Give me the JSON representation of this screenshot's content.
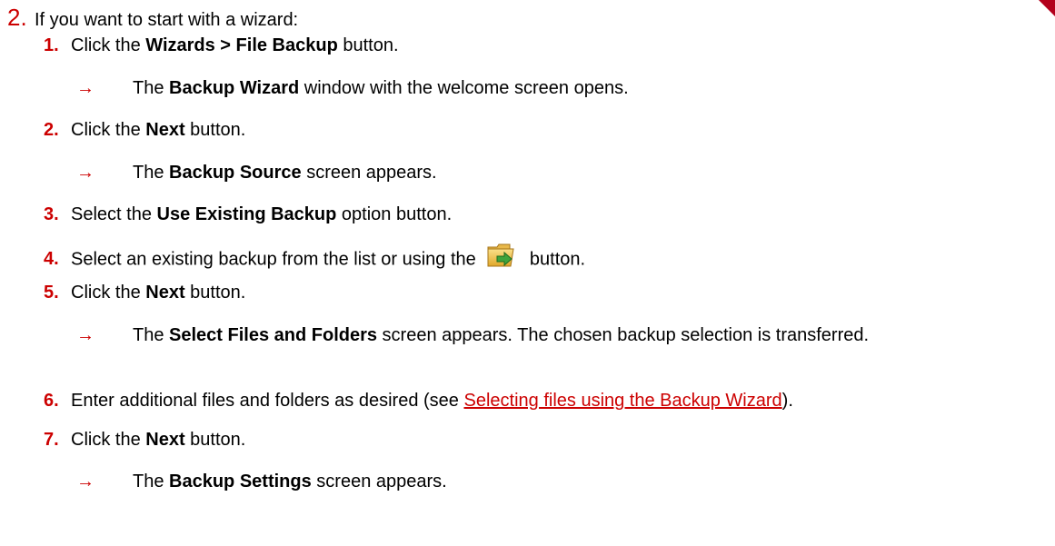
{
  "step": {
    "number": "2.",
    "text": "If you want to start with a wizard:"
  },
  "arrow_glyph": "→",
  "substeps": [
    {
      "num": "1.",
      "pre": "Click the ",
      "bold": "Wizards > File Backup",
      "post": " button."
    },
    {
      "num": "2.",
      "pre": "Click the ",
      "bold": "Next",
      "post": " button."
    },
    {
      "num": "3.",
      "pre": "Select the ",
      "bold": "Use Existing Backup",
      "post": " option button."
    },
    {
      "num": "4.",
      "pre": "Select an existing backup from the list or using the ",
      "icon": "open-folder-arrow-icon",
      "post": " button."
    },
    {
      "num": "5.",
      "pre": "Click the ",
      "bold": "Next",
      "post": " button."
    },
    {
      "num": "6.",
      "pre": "Enter additional files and folders as desired (see ",
      "link": "Selecting files using the Backup Wizard",
      "post": ")."
    },
    {
      "num": "7.",
      "pre": "Click the ",
      "bold": "Next",
      "post": " button."
    }
  ],
  "results": [
    {
      "pre": "The ",
      "bold": "Backup Wizard",
      "post": " window with the welcome screen opens."
    },
    {
      "pre": "The ",
      "bold": "Backup Source",
      "post": " screen appears."
    },
    {
      "pre": "The ",
      "bold": "Select Files and Folders",
      "post": " screen appears. The chosen backup selection is transferred."
    },
    {
      "pre": "The ",
      "bold": "Backup Settings",
      "post": " screen appears."
    }
  ],
  "colors": {
    "accent": "#cc0000",
    "corner": "#b3001b"
  }
}
